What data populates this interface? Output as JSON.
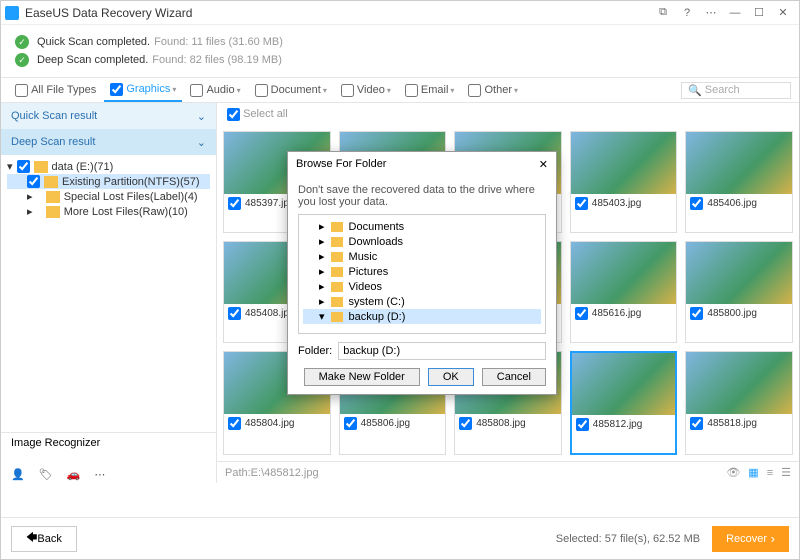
{
  "app_title": "EaseUS Data Recovery Wizard",
  "status": {
    "quick": {
      "label": "Quick Scan completed.",
      "detail": "Found: 11 files (31.60 MB)"
    },
    "deep": {
      "label": "Deep Scan completed.",
      "detail": "Found: 82 files (98.19 MB)"
    }
  },
  "filters": {
    "all": "All File Types",
    "graphics": "Graphics",
    "audio": "Audio",
    "document": "Document",
    "video": "Video",
    "email": "Email",
    "other": "Other",
    "search_placeholder": "Search"
  },
  "side": {
    "quick_header": "Quick Scan result",
    "deep_header": "Deep Scan result",
    "tree": {
      "root": "data (E:)(71)",
      "n1": "Existing Partition(NTFS)(57)",
      "n2": "Special Lost Files(Label)(4)",
      "n3": "More Lost Files(Raw)(10)"
    },
    "recognizer": "Image Recognizer"
  },
  "select_all": "Select all",
  "thumbs": [
    "485397.jpg",
    "",
    "",
    "485403.jpg",
    "485406.jpg",
    "485408.jpg",
    "",
    "",
    "485616.jpg",
    "485800.jpg",
    "485804.jpg",
    "485806.jpg",
    "485808.jpg",
    "485812.jpg",
    "485818.jpg"
  ],
  "selected_index": 13,
  "pathbar": {
    "path": "Path:E:\\485812.jpg"
  },
  "footer": {
    "back": "Back",
    "selected": "Selected: 57 file(s), 62.52 MB",
    "recover": "Recover"
  },
  "modal": {
    "title": "Browse For Folder",
    "hint": "Don't save the recovered data to the drive where you lost your data.",
    "nodes": [
      "Documents",
      "Downloads",
      "Music",
      "Pictures",
      "Videos",
      "system (C:)",
      "backup (D:)"
    ],
    "sel_index": 6,
    "folder_label": "Folder:",
    "folder_value": "backup (D:)",
    "make_new": "Make New Folder",
    "ok": "OK",
    "cancel": "Cancel"
  }
}
